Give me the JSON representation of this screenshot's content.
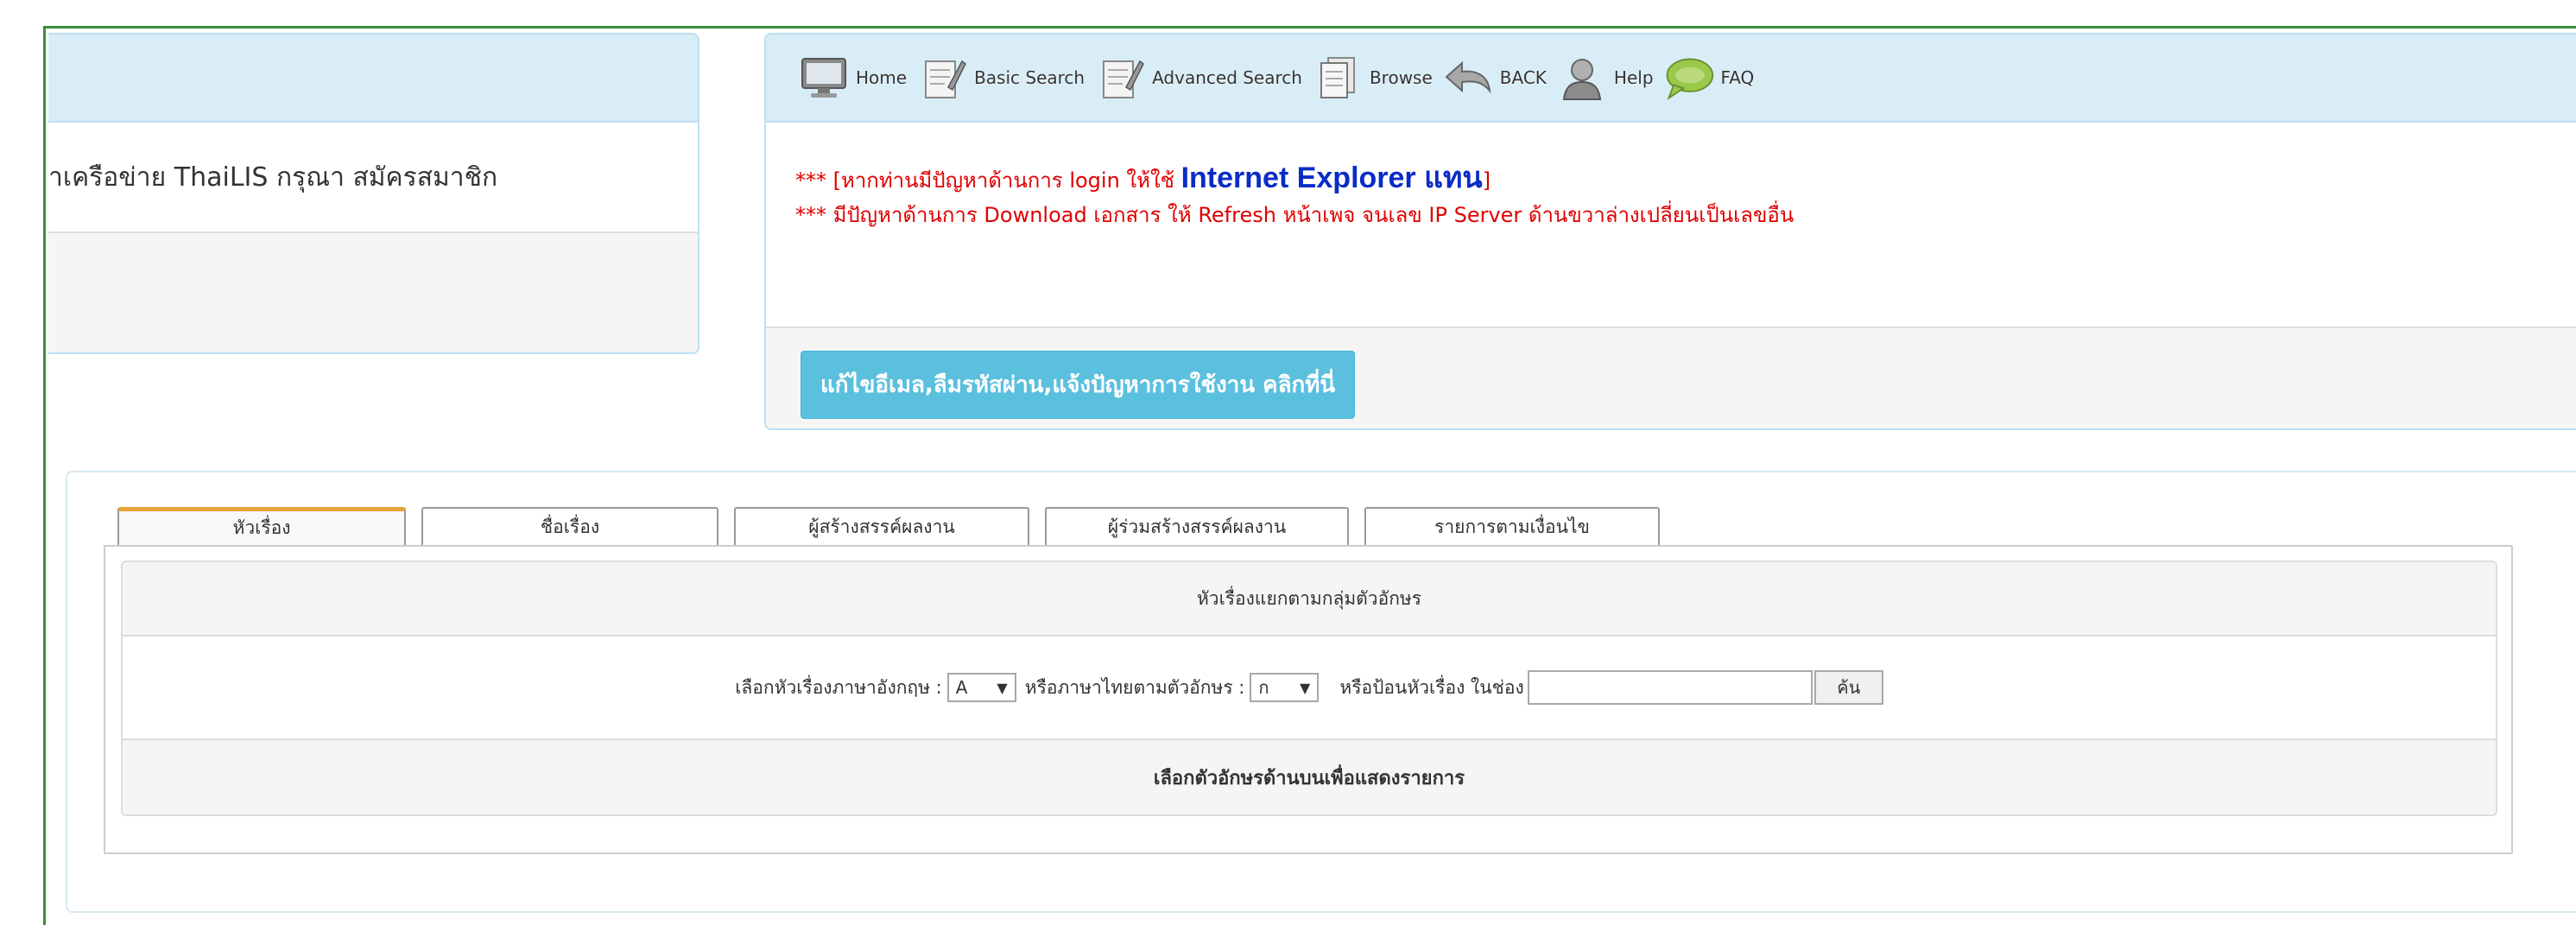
{
  "left_panel": {
    "message": "าเครือข่าย ThaiLIS กรุณา สมัครสมาชิก"
  },
  "nav": {
    "items": [
      {
        "label": "Home",
        "icon": "monitor-icon"
      },
      {
        "label": "Basic Search",
        "icon": "document-edit-icon"
      },
      {
        "label": "Advanced Search",
        "icon": "document-edit-icon"
      },
      {
        "label": "Browse",
        "icon": "documents-icon"
      },
      {
        "label": "BACK",
        "icon": "back-arrow-icon"
      },
      {
        "label": "Help",
        "icon": "person-help-icon"
      },
      {
        "label": "FAQ",
        "icon": "speech-bubble-icon"
      }
    ]
  },
  "notice": {
    "line1_prefix": "*** [หากท่านมีปัญหาด้านการ login ให้ใช้ ",
    "line1_highlight": "Internet Explorer แทน",
    "line1_suffix": "]",
    "line2": "*** มีปัญหาด้านการ Download เอกสาร ให้ Refresh หน้าเพจ จนเลข IP Server ด้านขวาล่างเปลี่ยนเป็นเลขอื่น"
  },
  "help_button": {
    "label": "แก้ไขอีเมล,ลืมรหัสผ่าน,แจ้งปัญหาการใช้งาน คลิกที่นี่"
  },
  "tabs": [
    {
      "label": "หัวเรื่อง",
      "active": true
    },
    {
      "label": "ชื่อเรื่อง",
      "active": false
    },
    {
      "label": "ผู้สร้างสรรค์ผลงาน",
      "active": false
    },
    {
      "label": "ผู้ร่วมสร้างสรรค์ผลงาน",
      "active": false
    },
    {
      "label": "รายการตามเงื่อนไข",
      "active": false
    }
  ],
  "browse": {
    "heading": "หัวเรื่องแยกตามกลุ่มตัวอักษร",
    "english_label": "เลือกหัวเรื่องภาษาอังกฤษ :",
    "english_selected": "A",
    "thai_label": "หรือภาษาไทยตามตัวอักษร :",
    "thai_selected": "ก",
    "input_label": "หรือป้อนหัวเรื่อง ในช่อง",
    "input_value": "",
    "search_button": "ค้น",
    "footer": "เลือกตัวอักษรด้านบนเพื่อแสดงรายการ"
  },
  "colors": {
    "accent_green": "#3c8c3c",
    "panel_blue": "#d9edf7",
    "notice_red": "#e00000",
    "highlight_blue": "#0a2cc6",
    "button_blue": "#5bc0de",
    "active_tab": "#e8a33a"
  }
}
